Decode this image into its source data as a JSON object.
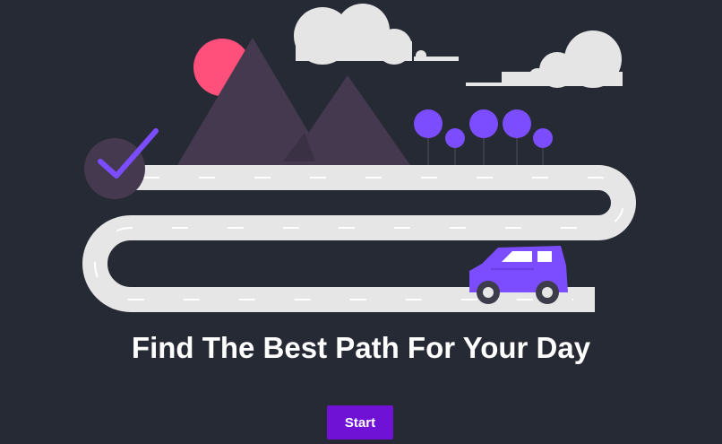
{
  "hero": {
    "headline": "Find The Best Path For Your Day",
    "start_label": "Start"
  },
  "colors": {
    "background": "#262a34",
    "accent": "#7012d6",
    "car": "#7c4dff",
    "sun": "#ff4f7b",
    "mountain": "#45394f",
    "road": "#e6e6e6",
    "cloud": "#e5e5e5"
  }
}
